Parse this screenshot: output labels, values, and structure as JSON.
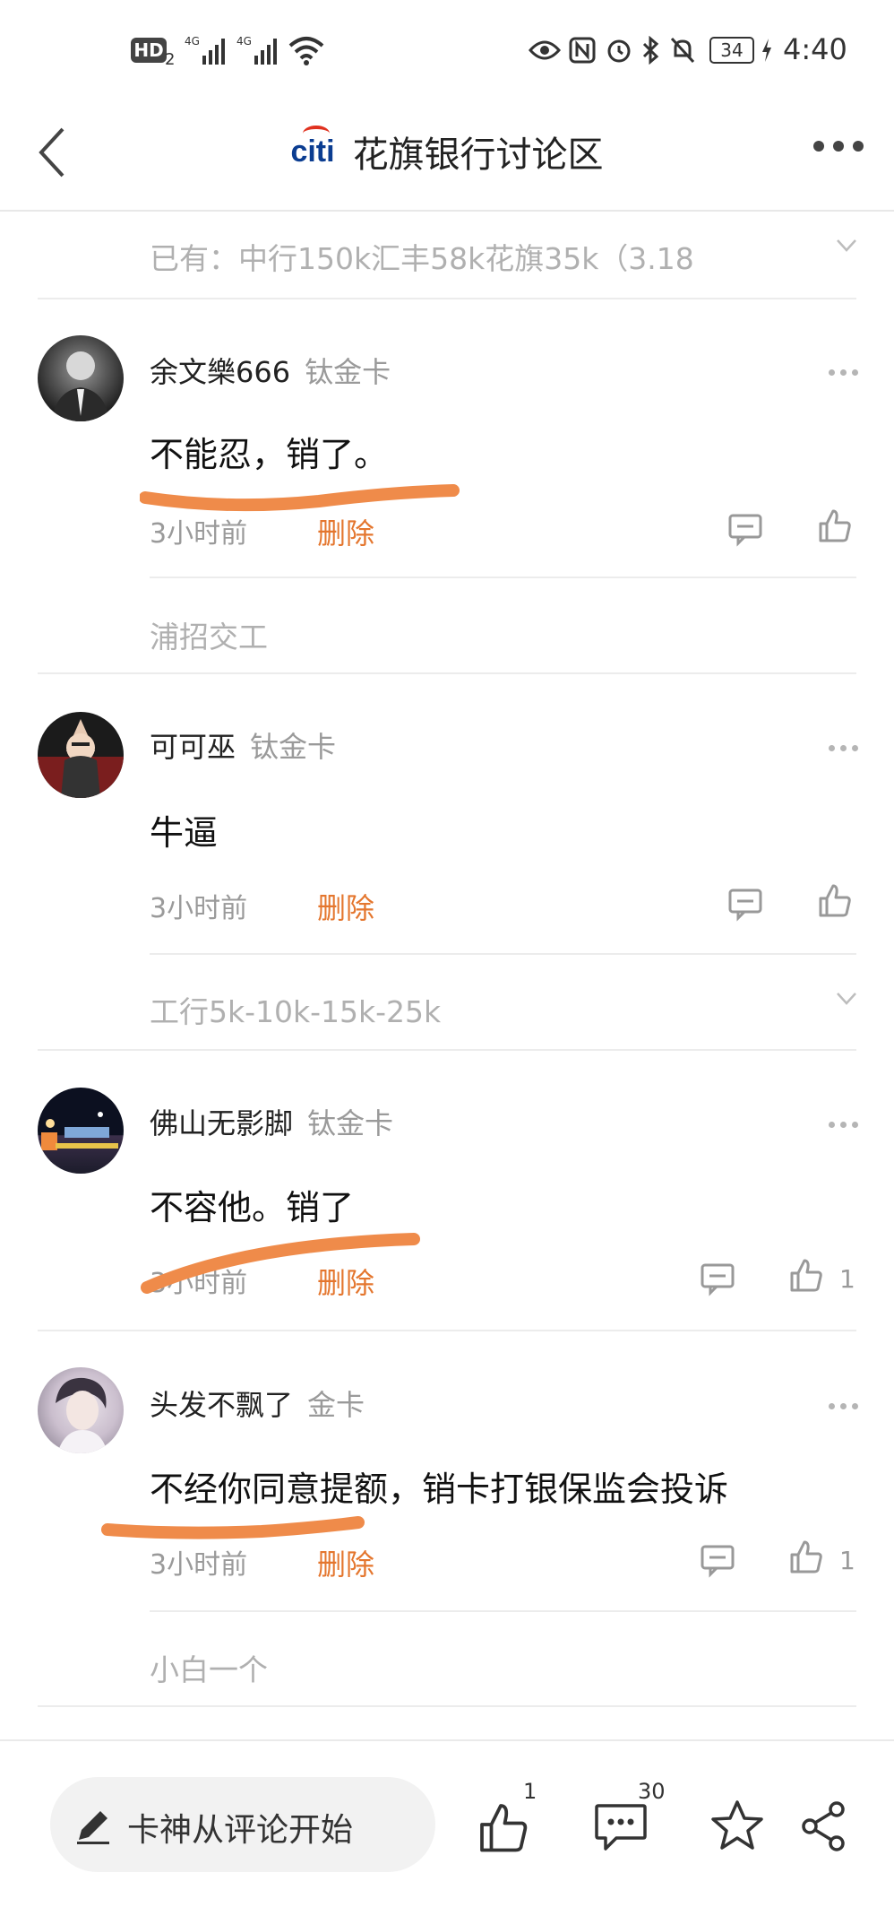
{
  "status_bar": {
    "time": "4:40",
    "battery": "34",
    "hd": "HD",
    "hd_sub": "2",
    "net1": "4G",
    "net2": "4G"
  },
  "header": {
    "logo_text": "citi",
    "title": "花旗银行讨论区"
  },
  "top_reply": {
    "text": "已有：中行150k汇丰58k花旗35k（3.18"
  },
  "comments": [
    {
      "name": "余文樂666",
      "badge": "钛金卡",
      "body": "不能忍，销了。",
      "time": "3小时前",
      "delete": "删除",
      "likes": "",
      "reply_preview": "浦招交工"
    },
    {
      "name": "可可巫",
      "badge": "钛金卡",
      "body": "牛逼",
      "time": "3小时前",
      "delete": "删除",
      "likes": "",
      "reply_preview": "工行5k-10k-15k-25k"
    },
    {
      "name": "佛山无影脚",
      "badge": "钛金卡",
      "body": "不容他。销了",
      "time": "3小时前",
      "delete": "删除",
      "likes": "1"
    },
    {
      "name": "头发不飘了",
      "badge": "金卡",
      "body": "不经你同意提额，销卡打银保监会投诉",
      "time": "3小时前",
      "delete": "删除",
      "likes": "1",
      "reply_preview": "小白一个"
    }
  ],
  "bottom_bar": {
    "input_placeholder": "卡神从评论开始",
    "like_count": "1",
    "comment_count": "30"
  },
  "colors": {
    "delete": "#e4762e",
    "highlight_stroke": "#ef8b4a",
    "citi_blue": "#0b3d91",
    "citi_red": "#e0311f"
  }
}
